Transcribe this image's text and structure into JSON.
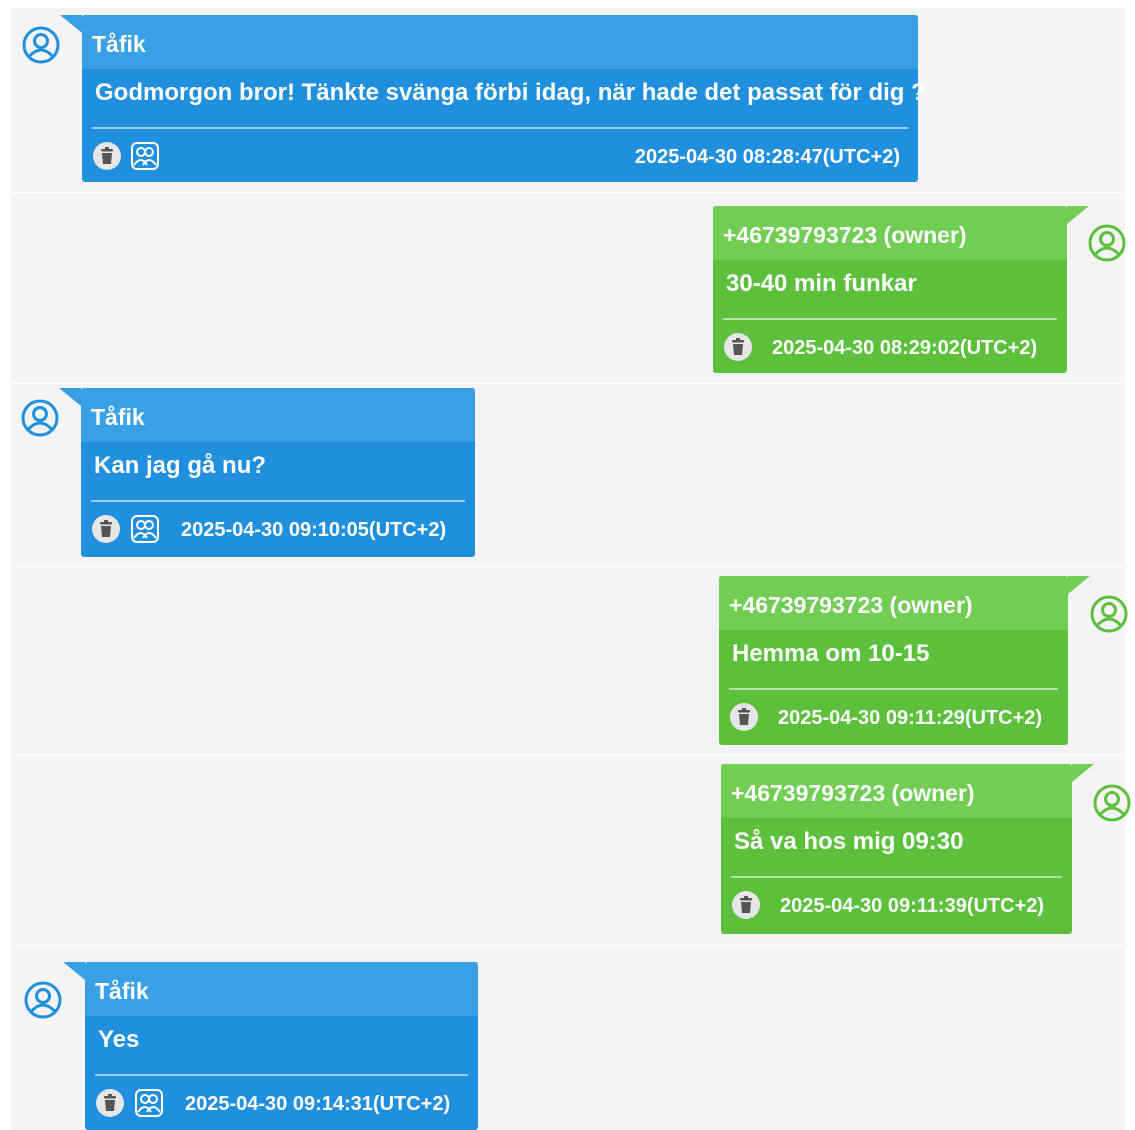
{
  "colors": {
    "incoming_bubble": "#1f8fde",
    "incoming_header": "#3aa0e6",
    "outgoing_bubble": "#5cc03c",
    "outgoing_header": "#72cd55",
    "background": "#f4f4f4"
  },
  "icons": {
    "avatar": "user-avatar-icon",
    "delete": "trash-icon",
    "contacts": "contacts-icon"
  },
  "messages": [
    {
      "direction": "incoming",
      "sender": "Tåfik",
      "text": "Godmorgon bror! Tänkte svänga förbi idag, när hade det passat för dig ?",
      "timestamp": "2025-04-30 08:28:47(UTC+2)"
    },
    {
      "direction": "outgoing",
      "sender": "+46739793723 (owner)",
      "text": "30-40 min funkar",
      "timestamp": "2025-04-30 08:29:02(UTC+2)"
    },
    {
      "direction": "incoming",
      "sender": "Tåfik",
      "text": "Kan jag gå nu?",
      "timestamp": "2025-04-30 09:10:05(UTC+2)"
    },
    {
      "direction": "outgoing",
      "sender": "+46739793723 (owner)",
      "text": "Hemma om 10-15",
      "timestamp": "2025-04-30 09:11:29(UTC+2)"
    },
    {
      "direction": "outgoing",
      "sender": "+46739793723 (owner)",
      "text": "Så va hos mig 09:30",
      "timestamp": "2025-04-30 09:11:39(UTC+2)"
    },
    {
      "direction": "incoming",
      "sender": "Tåfik",
      "text": "Yes",
      "timestamp": "2025-04-30 09:14:31(UTC+2)"
    }
  ]
}
